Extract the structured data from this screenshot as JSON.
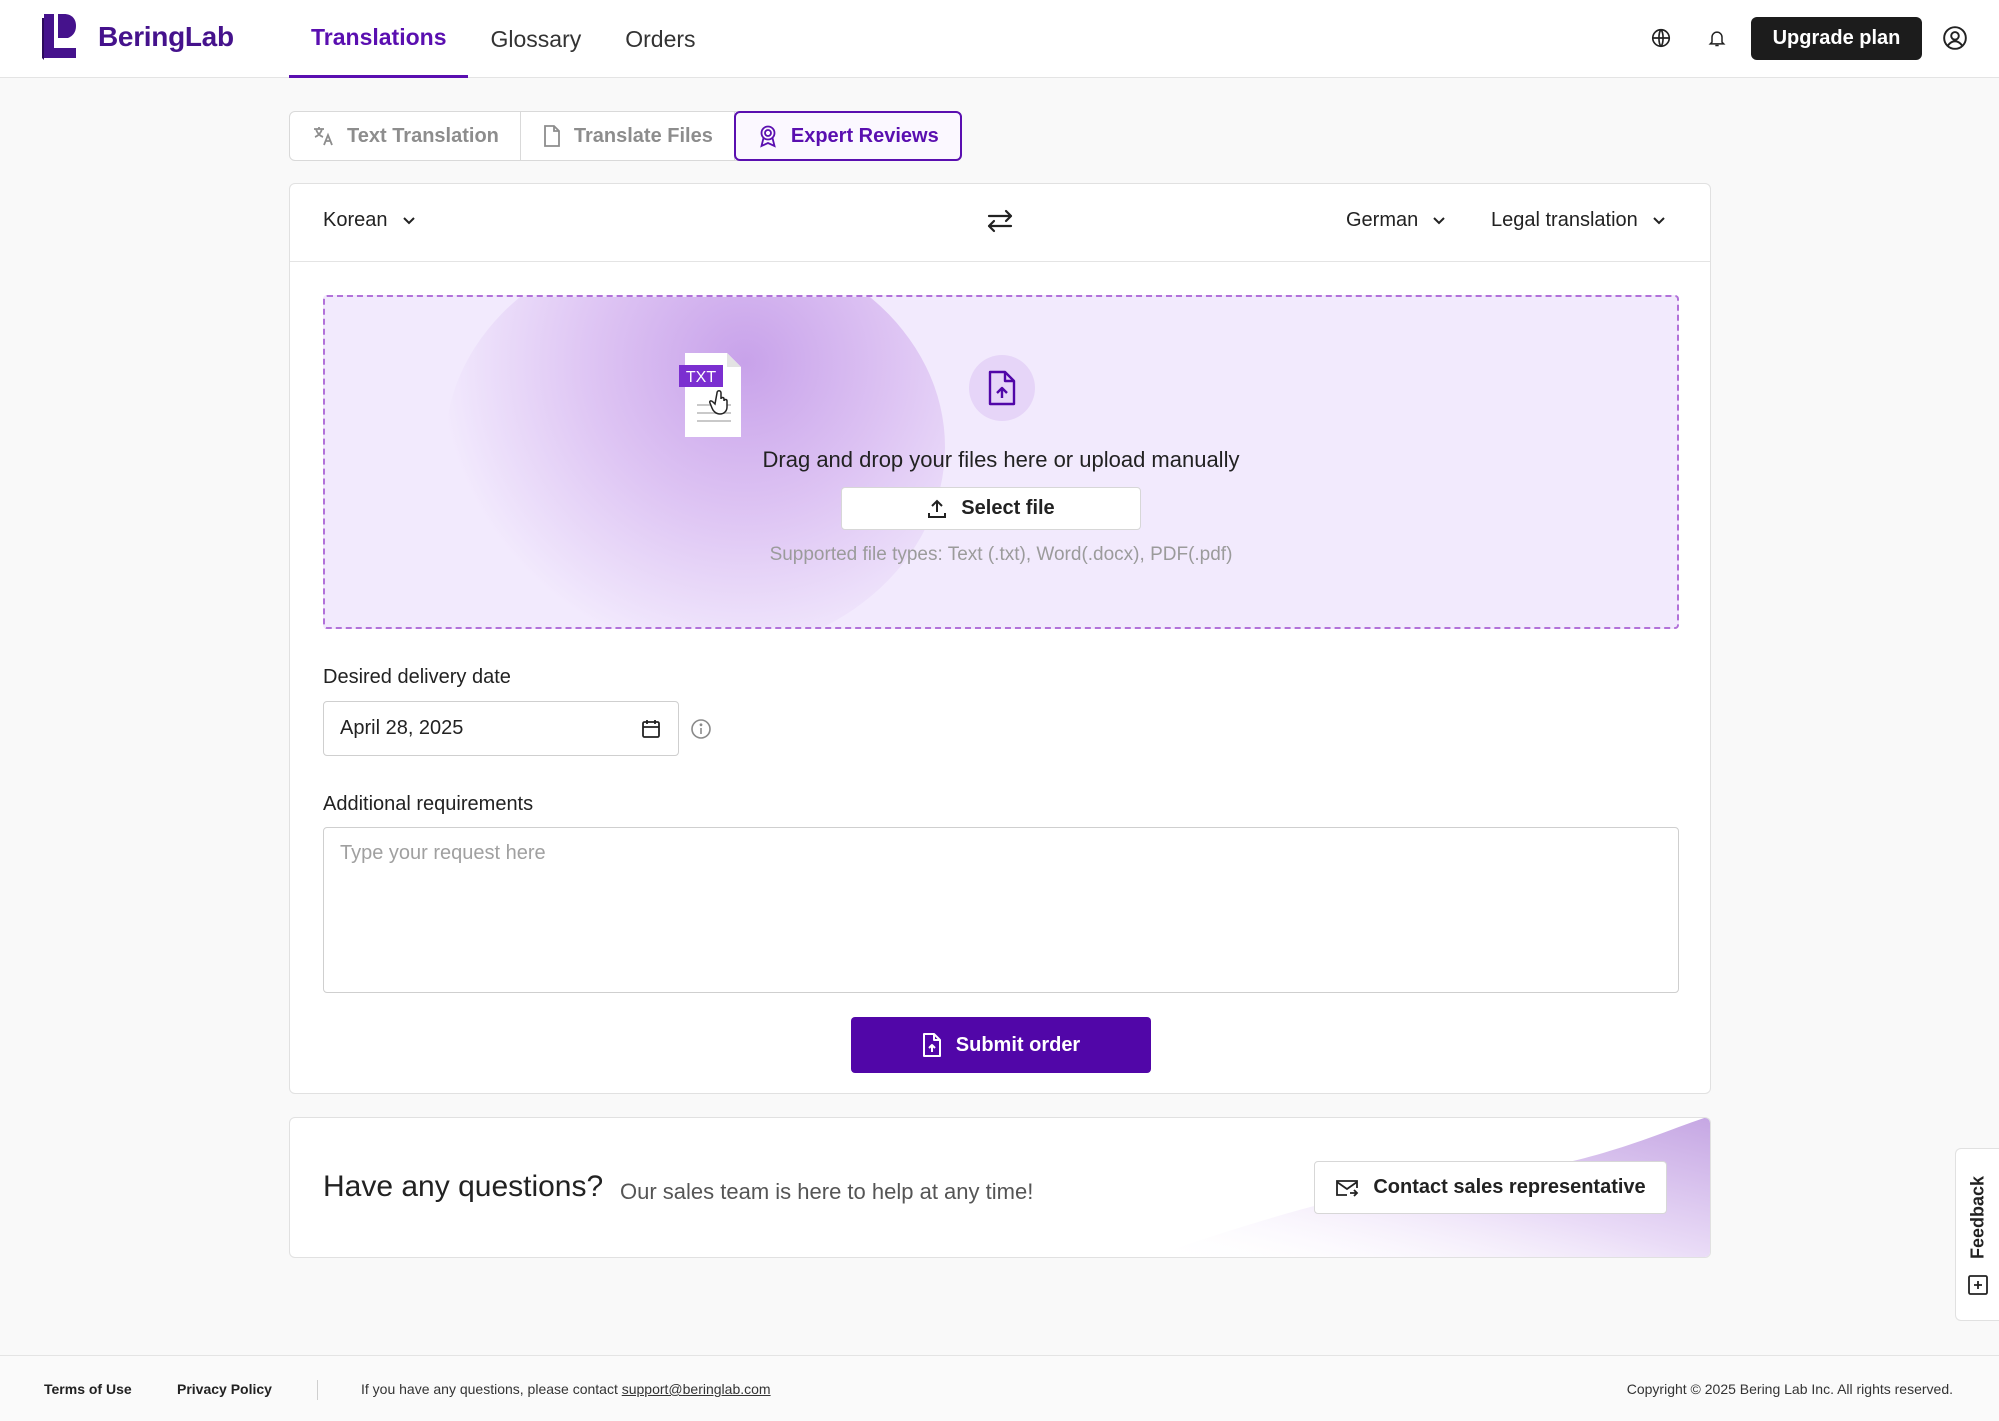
{
  "brand": {
    "name": "BeringLab",
    "color": "#45128c",
    "accent": "#5106a8"
  },
  "nav": {
    "items": [
      {
        "label": "Translations",
        "active": true
      },
      {
        "label": "Glossary",
        "active": false
      },
      {
        "label": "Orders",
        "active": false
      }
    ],
    "upgrade_label": "Upgrade plan",
    "icons": [
      "globe-icon",
      "bell-icon",
      "user-circle-icon"
    ]
  },
  "mode_tabs": [
    {
      "label": "Text Translation",
      "icon": "translate-icon",
      "active": false
    },
    {
      "label": "Translate Files",
      "icon": "file-icon",
      "active": false
    },
    {
      "label": "Expert Reviews",
      "icon": "award-icon",
      "active": true
    }
  ],
  "languages": {
    "source": "Korean",
    "target": "German",
    "domain": "Legal translation"
  },
  "dropzone": {
    "file_badge": "TXT",
    "title": "Drag and drop your files here or upload manually",
    "select_label": "Select file",
    "supported": "Supported file types: Text (.txt), Word(.docx), PDF(.pdf)"
  },
  "delivery": {
    "label": "Desired delivery date",
    "value": "April 28, 2025"
  },
  "requirements": {
    "label": "Additional requirements",
    "placeholder": "Type your request here"
  },
  "submit_label": "Submit order",
  "questions": {
    "title": "Have any questions?",
    "subtitle": "Our sales team is here to help at any time!",
    "contact_label": "Contact sales representative"
  },
  "feedback_label": "Feedback",
  "footer": {
    "terms": "Terms of Use",
    "privacy": "Privacy Policy",
    "contact_prefix": "If you have any questions, please contact",
    "email": "support@beringlab.com",
    "copyright": "Copyright © 2025 Bering Lab Inc. All rights reserved."
  }
}
